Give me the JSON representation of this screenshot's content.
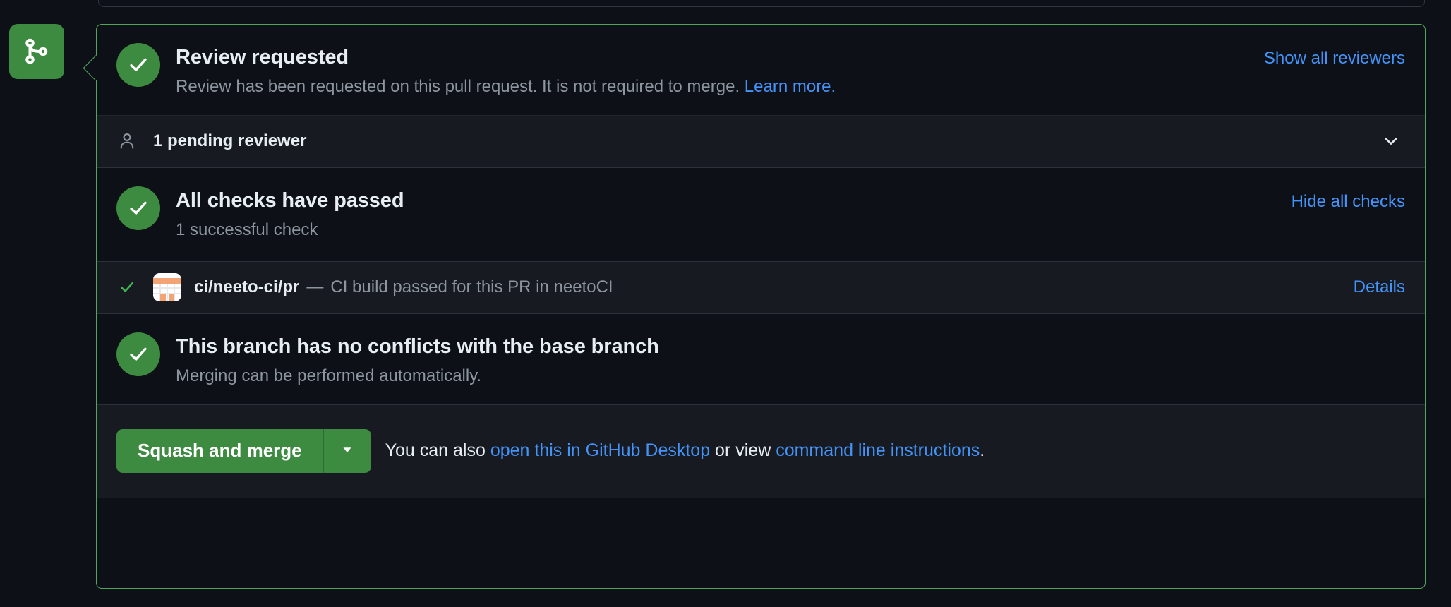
{
  "state_badge": {
    "icon": "git-merge-icon",
    "color": "#3d8b40"
  },
  "merge_box": {
    "border_color": "#51a657",
    "review": {
      "icon": "check-circle-icon",
      "title": "Review requested",
      "description_prefix": "Review has been requested on this pull request. It is not required to merge. ",
      "description_link": "Learn more.",
      "action_label": "Show all reviewers"
    },
    "pending_reviewers": {
      "icon": "person-icon",
      "label": "1 pending reviewer",
      "toggle_icon": "chevron-down-icon"
    },
    "checks": {
      "icon": "check-circle-icon",
      "title": "All checks have passed",
      "subtitle": "1 successful check",
      "action_label": "Hide all checks",
      "items": [
        {
          "status_icon": "check-icon",
          "logo": "neetoci-logo-icon",
          "name": "ci/neeto-ci/pr",
          "separator": "—",
          "description": "CI build passed for this PR in neetoCI",
          "details_label": "Details"
        }
      ]
    },
    "conflicts": {
      "icon": "check-circle-icon",
      "title": "This branch has no conflicts with the base branch",
      "subtitle": "Merging can be performed automatically."
    },
    "footer": {
      "merge_button_label": "Squash and merge",
      "merge_dropdown_icon": "caret-down-icon",
      "note_prefix": "You can also ",
      "note_link1": "open this in GitHub Desktop",
      "note_middle": " or view ",
      "note_link2": "command line instructions",
      "note_suffix": "."
    }
  },
  "colors": {
    "success_green": "#3d8b40",
    "border_green": "#51a657",
    "link_blue": "#4493f8",
    "page_bg": "#0d1117",
    "row_bg": "#171b21",
    "muted_text": "#8d959e"
  }
}
